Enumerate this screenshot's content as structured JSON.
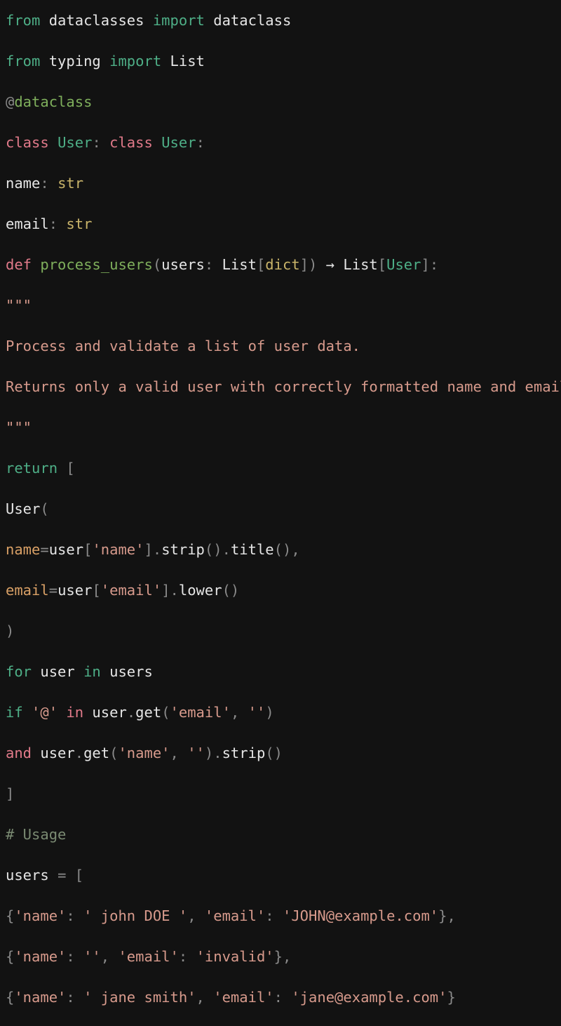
{
  "editor": {
    "language": "python",
    "background_color": "#121212",
    "default_text_color": "#E6E6E6",
    "font_size_px": 20.5,
    "line_height_px": 58,
    "clipped_at_right_edge": true
  },
  "theme": {
    "keyword_green": "#4EAF87",
    "keyword_pink": "#E17A8A",
    "punctuation": "#8A8A8A",
    "builtin_type": "#C9B46A",
    "string": "#D79A8C",
    "comment": "#7A8A72",
    "function_name": "#7FAF5C",
    "decorator": "#7FAF5C",
    "keyword_argument": "#D9A066",
    "class_name": "#4EAF87"
  },
  "lines": [
    {
      "index": 1,
      "text": "from dataclasses import dataclass",
      "tokens": [
        {
          "t": "from",
          "c": "tok-kw"
        },
        {
          "t": " dataclasses ",
          "c": "tok-name"
        },
        {
          "t": "import",
          "c": "tok-kw"
        },
        {
          "t": " dataclass",
          "c": "tok-name"
        }
      ]
    },
    {
      "index": 2,
      "text": "from typing import List",
      "tokens": [
        {
          "t": "from",
          "c": "tok-kw"
        },
        {
          "t": " typing ",
          "c": "tok-name"
        },
        {
          "t": "import",
          "c": "tok-kw"
        },
        {
          "t": " List",
          "c": "tok-name"
        }
      ]
    },
    {
      "index": 3,
      "text": "@dataclass",
      "tokens": [
        {
          "t": "@",
          "c": "tok-punct"
        },
        {
          "t": "dataclass",
          "c": "tok-deco"
        }
      ]
    },
    {
      "index": 4,
      "text": "class User: class User:",
      "tokens": [
        {
          "t": "class",
          "c": "tok-kw2"
        },
        {
          "t": " ",
          "c": "tok-name"
        },
        {
          "t": "User",
          "c": "tok-type"
        },
        {
          "t": ":",
          "c": "tok-punct"
        },
        {
          "t": " ",
          "c": "tok-name"
        },
        {
          "t": "class",
          "c": "tok-kw2"
        },
        {
          "t": " ",
          "c": "tok-name"
        },
        {
          "t": "User",
          "c": "tok-type"
        },
        {
          "t": ":",
          "c": "tok-punct"
        }
      ]
    },
    {
      "index": 5,
      "text": "name: str",
      "tokens": [
        {
          "t": "name",
          "c": "tok-name"
        },
        {
          "t": ": ",
          "c": "tok-punct"
        },
        {
          "t": "str",
          "c": "tok-builtin"
        }
      ]
    },
    {
      "index": 6,
      "text": "email: str",
      "tokens": [
        {
          "t": "email",
          "c": "tok-name"
        },
        {
          "t": ": ",
          "c": "tok-punct"
        },
        {
          "t": "str",
          "c": "tok-builtin"
        }
      ]
    },
    {
      "index": 7,
      "text": "def process_users(users: List[dict]) → List[User]:",
      "tokens": [
        {
          "t": "def",
          "c": "tok-kw2"
        },
        {
          "t": " ",
          "c": "tok-name"
        },
        {
          "t": "process_users",
          "c": "tok-func"
        },
        {
          "t": "(",
          "c": "tok-punct"
        },
        {
          "t": "users",
          "c": "tok-name"
        },
        {
          "t": ": ",
          "c": "tok-punct"
        },
        {
          "t": "List",
          "c": "tok-name"
        },
        {
          "t": "[",
          "c": "tok-punct"
        },
        {
          "t": "dict",
          "c": "tok-builtin"
        },
        {
          "t": "]",
          "c": "tok-punct"
        },
        {
          "t": ")",
          "c": "tok-punct"
        },
        {
          "t": " → ",
          "c": "tok-op"
        },
        {
          "t": "List",
          "c": "tok-name"
        },
        {
          "t": "[",
          "c": "tok-punct"
        },
        {
          "t": "User",
          "c": "tok-type"
        },
        {
          "t": "]",
          "c": "tok-punct"
        },
        {
          "t": ":",
          "c": "tok-punct"
        }
      ]
    },
    {
      "index": 8,
      "text": "\"\"\"",
      "tokens": [
        {
          "t": "\"\"\"",
          "c": "tok-str"
        }
      ]
    },
    {
      "index": 9,
      "text": "Process and validate a list of user data.",
      "tokens": [
        {
          "t": "Process and validate a list of user data.",
          "c": "tok-str"
        }
      ]
    },
    {
      "index": 10,
      "text": "Returns only a valid user with correctly formatted name and email.",
      "tokens": [
        {
          "t": "Returns only a valid user with correctly formatted name and email.",
          "c": "tok-str"
        }
      ]
    },
    {
      "index": 11,
      "text": "\"\"\"",
      "tokens": [
        {
          "t": "\"\"\"",
          "c": "tok-str"
        }
      ]
    },
    {
      "index": 12,
      "text": "return [",
      "tokens": [
        {
          "t": "return",
          "c": "tok-kw"
        },
        {
          "t": " ",
          "c": "tok-name"
        },
        {
          "t": "[",
          "c": "tok-punct"
        }
      ]
    },
    {
      "index": 13,
      "text": "User(",
      "tokens": [
        {
          "t": "User",
          "c": "tok-name"
        },
        {
          "t": "(",
          "c": "tok-punct"
        }
      ]
    },
    {
      "index": 14,
      "text": "name=user['name'].strip().title(),",
      "tokens": [
        {
          "t": "name",
          "c": "tok-param"
        },
        {
          "t": "=",
          "c": "tok-punct"
        },
        {
          "t": "user",
          "c": "tok-name"
        },
        {
          "t": "[",
          "c": "tok-punct"
        },
        {
          "t": "'name'",
          "c": "tok-str"
        },
        {
          "t": "]",
          "c": "tok-punct"
        },
        {
          "t": ".",
          "c": "tok-punct"
        },
        {
          "t": "strip",
          "c": "tok-name"
        },
        {
          "t": "()",
          "c": "tok-punct"
        },
        {
          "t": ".",
          "c": "tok-punct"
        },
        {
          "t": "title",
          "c": "tok-name"
        },
        {
          "t": "()",
          "c": "tok-punct"
        },
        {
          "t": ",",
          "c": "tok-punct"
        }
      ]
    },
    {
      "index": 15,
      "text": "email=user['email'].lower()",
      "tokens": [
        {
          "t": "email",
          "c": "tok-param"
        },
        {
          "t": "=",
          "c": "tok-punct"
        },
        {
          "t": "user",
          "c": "tok-name"
        },
        {
          "t": "[",
          "c": "tok-punct"
        },
        {
          "t": "'email'",
          "c": "tok-str"
        },
        {
          "t": "]",
          "c": "tok-punct"
        },
        {
          "t": ".",
          "c": "tok-punct"
        },
        {
          "t": "lower",
          "c": "tok-name"
        },
        {
          "t": "()",
          "c": "tok-punct"
        }
      ]
    },
    {
      "index": 16,
      "text": ")",
      "tokens": [
        {
          "t": ")",
          "c": "tok-punct"
        }
      ]
    },
    {
      "index": 17,
      "text": "for user in users",
      "tokens": [
        {
          "t": "for",
          "c": "tok-kw"
        },
        {
          "t": " user ",
          "c": "tok-name"
        },
        {
          "t": "in",
          "c": "tok-kw"
        },
        {
          "t": " users",
          "c": "tok-name"
        }
      ]
    },
    {
      "index": 18,
      "text": "if '@' in user.get('email', '')",
      "tokens": [
        {
          "t": "if",
          "c": "tok-kw"
        },
        {
          "t": " ",
          "c": "tok-name"
        },
        {
          "t": "'@'",
          "c": "tok-str"
        },
        {
          "t": " ",
          "c": "tok-name"
        },
        {
          "t": "in",
          "c": "tok-kw2"
        },
        {
          "t": " user",
          "c": "tok-name"
        },
        {
          "t": ".",
          "c": "tok-punct"
        },
        {
          "t": "get",
          "c": "tok-name"
        },
        {
          "t": "(",
          "c": "tok-punct"
        },
        {
          "t": "'email'",
          "c": "tok-str"
        },
        {
          "t": ", ",
          "c": "tok-punct"
        },
        {
          "t": "''",
          "c": "tok-str"
        },
        {
          "t": ")",
          "c": "tok-punct"
        }
      ]
    },
    {
      "index": 19,
      "text": "and user.get('name', '').strip()",
      "tokens": [
        {
          "t": "and",
          "c": "tok-kw2"
        },
        {
          "t": " user",
          "c": "tok-name"
        },
        {
          "t": ".",
          "c": "tok-punct"
        },
        {
          "t": "get",
          "c": "tok-name"
        },
        {
          "t": "(",
          "c": "tok-punct"
        },
        {
          "t": "'name'",
          "c": "tok-str"
        },
        {
          "t": ", ",
          "c": "tok-punct"
        },
        {
          "t": "''",
          "c": "tok-str"
        },
        {
          "t": ")",
          "c": "tok-punct"
        },
        {
          "t": ".",
          "c": "tok-punct"
        },
        {
          "t": "strip",
          "c": "tok-name"
        },
        {
          "t": "()",
          "c": "tok-punct"
        }
      ]
    },
    {
      "index": 20,
      "text": "]",
      "tokens": [
        {
          "t": "]",
          "c": "tok-punct"
        }
      ]
    },
    {
      "index": 21,
      "text": "# Usage",
      "tokens": [
        {
          "t": "# Usage",
          "c": "tok-comment"
        }
      ]
    },
    {
      "index": 22,
      "text": "users = [",
      "tokens": [
        {
          "t": "users",
          "c": "tok-name"
        },
        {
          "t": " ",
          "c": "tok-name"
        },
        {
          "t": "=",
          "c": "tok-punct"
        },
        {
          "t": " ",
          "c": "tok-name"
        },
        {
          "t": "[",
          "c": "tok-punct"
        }
      ]
    },
    {
      "index": 23,
      "text": "{'name': ' john DOE ', 'email': 'JOHN@example.com'},",
      "tokens": [
        {
          "t": "{",
          "c": "tok-punct"
        },
        {
          "t": "'name'",
          "c": "tok-str"
        },
        {
          "t": ": ",
          "c": "tok-punct"
        },
        {
          "t": "' john DOE '",
          "c": "tok-str"
        },
        {
          "t": ", ",
          "c": "tok-punct"
        },
        {
          "t": "'email'",
          "c": "tok-str"
        },
        {
          "t": ": ",
          "c": "tok-punct"
        },
        {
          "t": "'JOHN@example.com'",
          "c": "tok-str"
        },
        {
          "t": "}",
          "c": "tok-punct"
        },
        {
          "t": ",",
          "c": "tok-punct"
        }
      ]
    },
    {
      "index": 24,
      "text": "{'name': '', 'email': 'invalid'},",
      "tokens": [
        {
          "t": "{",
          "c": "tok-punct"
        },
        {
          "t": "'name'",
          "c": "tok-str"
        },
        {
          "t": ": ",
          "c": "tok-punct"
        },
        {
          "t": "''",
          "c": "tok-str"
        },
        {
          "t": ", ",
          "c": "tok-punct"
        },
        {
          "t": "'email'",
          "c": "tok-str"
        },
        {
          "t": ": ",
          "c": "tok-punct"
        },
        {
          "t": "'invalid'",
          "c": "tok-str"
        },
        {
          "t": "}",
          "c": "tok-punct"
        },
        {
          "t": ",",
          "c": "tok-punct"
        }
      ]
    },
    {
      "index": 25,
      "text": "{'name': ' jane smith', 'email': 'jane@example.com'}",
      "tokens": [
        {
          "t": "{",
          "c": "tok-punct"
        },
        {
          "t": "'name'",
          "c": "tok-str"
        },
        {
          "t": ": ",
          "c": "tok-punct"
        },
        {
          "t": "' jane smith'",
          "c": "tok-str"
        },
        {
          "t": ", ",
          "c": "tok-punct"
        },
        {
          "t": "'email'",
          "c": "tok-str"
        },
        {
          "t": ": ",
          "c": "tok-punct"
        },
        {
          "t": "'jane@example.com'",
          "c": "tok-str"
        },
        {
          "t": "}",
          "c": "tok-punct"
        }
      ]
    }
  ]
}
